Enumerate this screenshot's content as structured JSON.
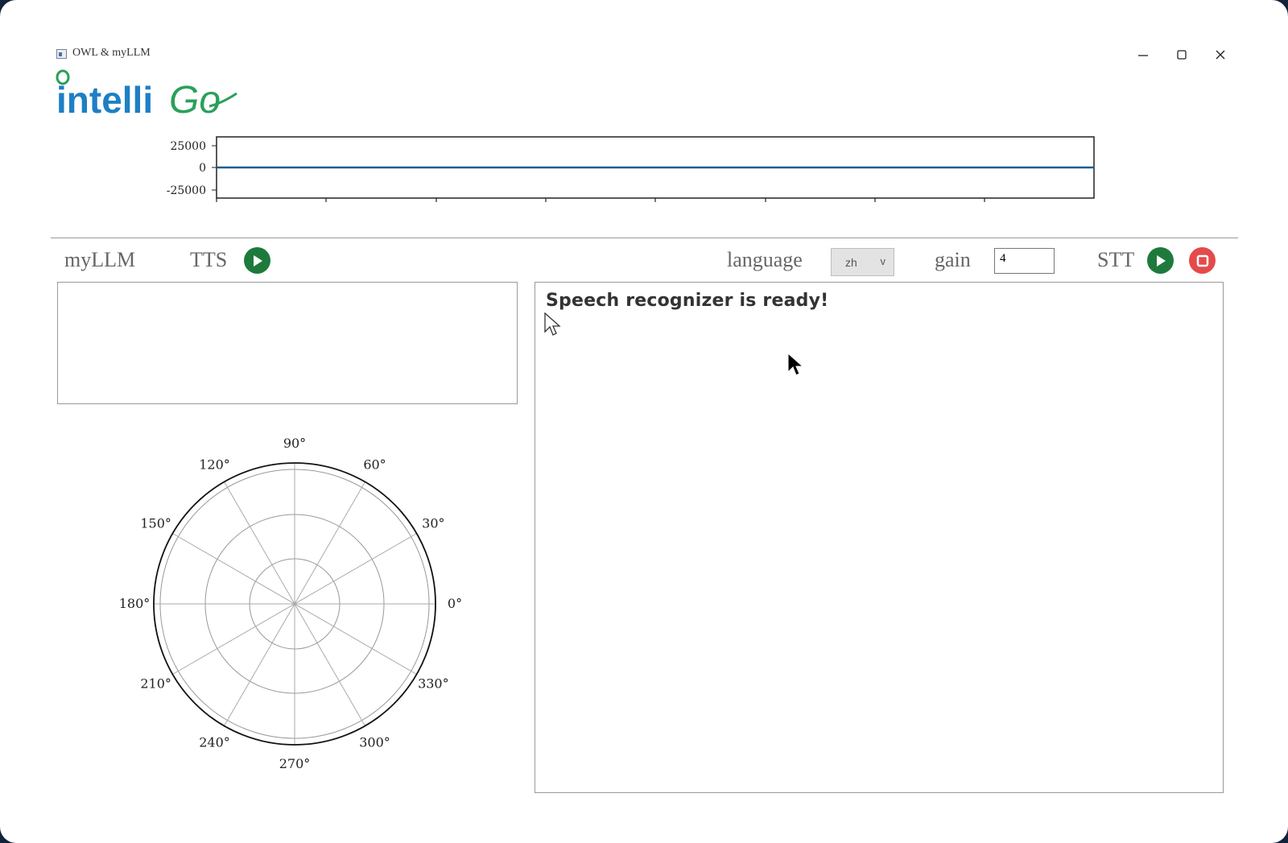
{
  "window": {
    "title": "OWL & myLLM",
    "logo_text_intelli": "intelli",
    "logo_text_go": "Go"
  },
  "waveform": {
    "y_ticks": [
      "25000",
      "0",
      "-25000"
    ]
  },
  "toolbar": {
    "myllm_label": "myLLM",
    "tts_label": "TTS",
    "language_label": "language",
    "language_value": "zh",
    "language_arrow": "v",
    "gain_label": "gain",
    "gain_value": "4",
    "stt_label": "STT"
  },
  "polar": {
    "angle_labels": [
      "0°",
      "30°",
      "60°",
      "90°",
      "120°",
      "150°",
      "180°",
      "210°",
      "240°",
      "270°",
      "300°",
      "330°"
    ]
  },
  "stt_output": {
    "text": "Speech recognizer is ready!"
  },
  "colors": {
    "play_green": "#1e7a3c",
    "stop_red": "#e44a4a",
    "logo_blue": "#1f7fc4",
    "logo_green": "#2aa05a"
  }
}
